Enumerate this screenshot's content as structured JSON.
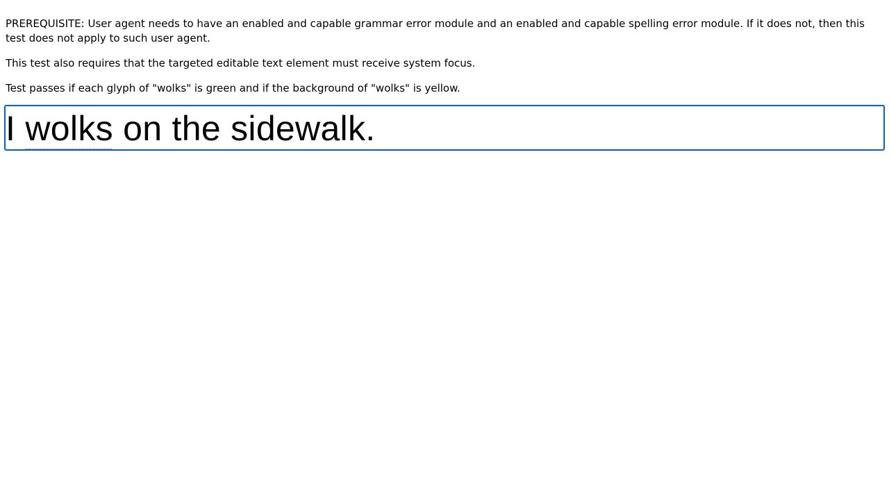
{
  "paragraphs": {
    "prerequisite": "PREREQUISITE: User agent needs to have an enabled and capable grammar error module and an enabled and capable spelling error module. If it does not, then this test does not apply to such user agent.",
    "focus_requirement": "This test also requires that the targeted editable text element must receive system focus.",
    "pass_condition": "Test passes if each glyph of \"wolks\" is green and if the background of \"wolks\" is yellow."
  },
  "editable": {
    "before": "I ",
    "error_word": "wolks",
    "after": " on the sidewalk."
  },
  "colors": {
    "focus_ring": "#0060df",
    "spelling_underline": "#c0392b"
  }
}
